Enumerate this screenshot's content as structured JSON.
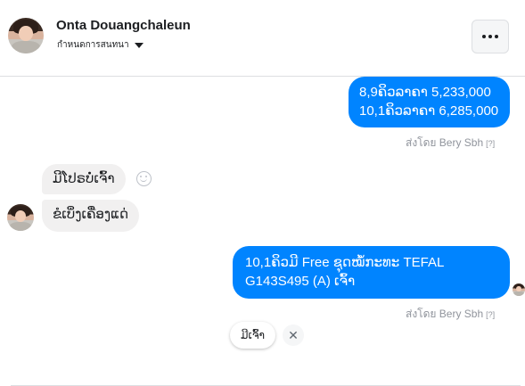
{
  "header": {
    "name": "Onta Douangchaleun",
    "subtitle": "กำหนดการสนทนา"
  },
  "messages": {
    "outgoing_1": {
      "line1": "8,9ຄິວລາຄາ 5,233,000",
      "line2": "10,1ຄິວລາຄາ 6,285,000"
    },
    "incoming_1": "ມີໂປຣບໍ່ເຈົ້າ",
    "incoming_2": "ຂໍເບິ່ງເຄື່ອງແດ່",
    "outgoing_2": {
      "line1": "10,1ຄິວມີ Free ຊຸດໝໍ້ກະທະ TEFAL",
      "line2": "G143S495 (A)  ເຈົ້າ"
    },
    "sent_by_1": "ส่งโดย Bery Sbh",
    "sent_by_2": "ส่งโดย Bery Sbh",
    "help_mark": "[?]"
  },
  "quick_reply": {
    "label": "ມີເຈົ້າ",
    "dismiss": "✕"
  },
  "colors": {
    "outgoing_bubble": "#0084ff",
    "incoming_bubble": "#f1f0f0",
    "meta_text": "#90949c"
  },
  "icons": {
    "more": "more-options-icon",
    "dropdown": "caret-down-icon",
    "emoji": "smiley-icon",
    "close": "close-icon"
  }
}
